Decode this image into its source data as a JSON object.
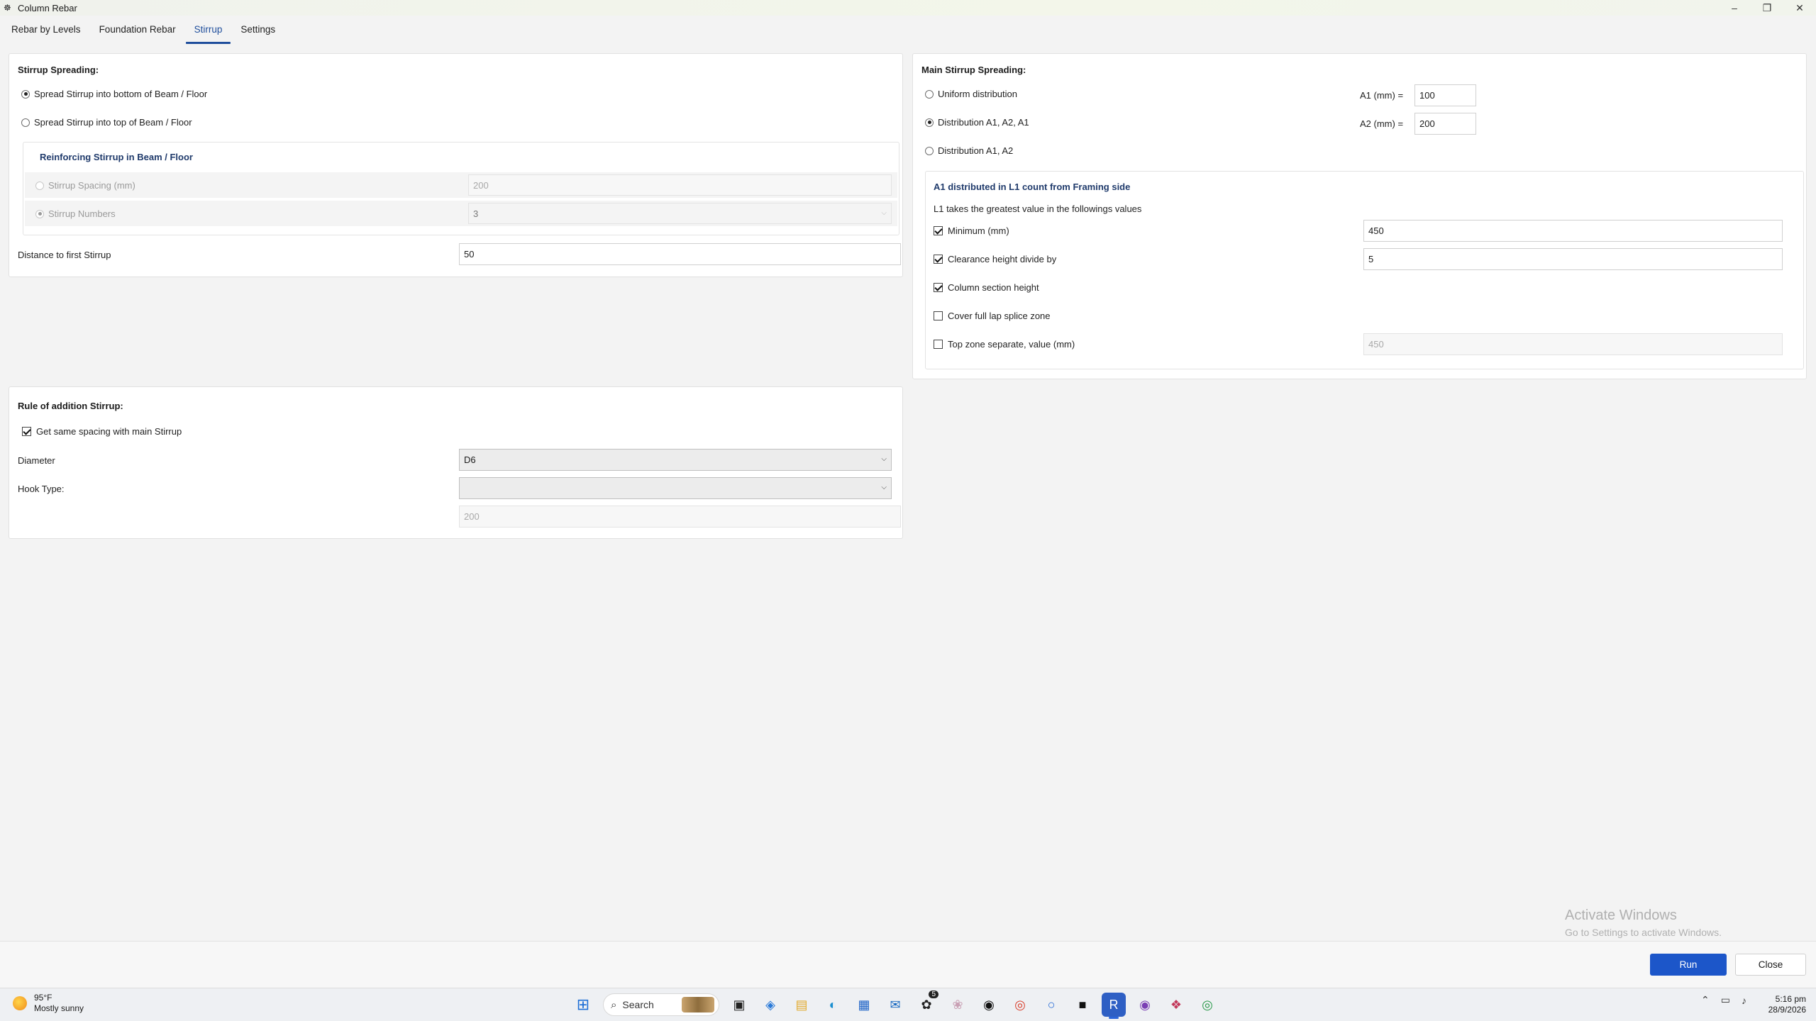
{
  "window": {
    "title": "Column Rebar",
    "app_icon": "rebar-app-icon"
  },
  "tabs": [
    {
      "label": "Rebar by Levels"
    },
    {
      "label": "Foundation Rebar"
    },
    {
      "label": "Stirrup",
      "active": true
    },
    {
      "label": "Settings"
    }
  ],
  "stirrup_spreading": {
    "title": "Stirrup Spreading:",
    "option_bottom": "Spread Stirrup into bottom of Beam / Floor",
    "option_top": "Spread Stirrup into top of Beam / Floor",
    "selected": "bottom",
    "reinforcing": {
      "title": "Reinforcing Stirrup in Beam / Floor",
      "spacing_label": "Stirrup Spacing (mm)",
      "spacing_value": "200",
      "numbers_label": "Stirrup Numbers",
      "numbers_value": "3",
      "selected": "numbers"
    },
    "distance_label": "Distance to first Stirrup",
    "distance_value": "50"
  },
  "main_stirrup": {
    "title": "Main Stirrup Spreading:",
    "option_uniform": "Uniform distribution",
    "option_a1a2a1": "Distribution A1, A2, A1",
    "option_a1a2": "Distribution A1, A2",
    "selected": "a1a2a1",
    "a1_label": "A1 (mm) =",
    "a1_value": "100",
    "a2_label": "A2 (mm) =",
    "a2_value": "200",
    "l1": {
      "title": "A1 distributed in L1 count from Framing side",
      "subtitle": "L1 takes the greatest value in the followings values",
      "minimum_label": "Minimum (mm)",
      "minimum_checked": true,
      "minimum_value": "450",
      "clearance_label": "Clearance height divide by",
      "clearance_checked": true,
      "clearance_value": "5",
      "section_label": "Column section height",
      "section_checked": true,
      "lap_label": "Cover full lap splice zone",
      "lap_checked": false,
      "top_label": "Top zone separate, value (mm)",
      "top_checked": false,
      "top_value": "450"
    }
  },
  "addition_rule": {
    "title": "Rule of addition Stirrup:",
    "same_spacing_label": "Get same spacing with main Stirrup",
    "same_spacing_checked": true,
    "diameter_label": "Diameter",
    "diameter_value": "D6",
    "hook_label": "Hook Type:",
    "hook_value": "",
    "spacing_value": "200"
  },
  "footer": {
    "run_label": "Run",
    "close_label": "Close",
    "watermark_title": "Activate Windows",
    "watermark_sub": "Go to Settings to activate Windows."
  },
  "taskbar": {
    "temperature": "95°F",
    "weather": "Mostly sunny",
    "search_label": "Search",
    "badge_count": "5",
    "time": "5:16 pm",
    "date": "28/9/2026"
  },
  "colors": {
    "accent": "#1f4e9c",
    "run_button": "#1c56c9"
  }
}
